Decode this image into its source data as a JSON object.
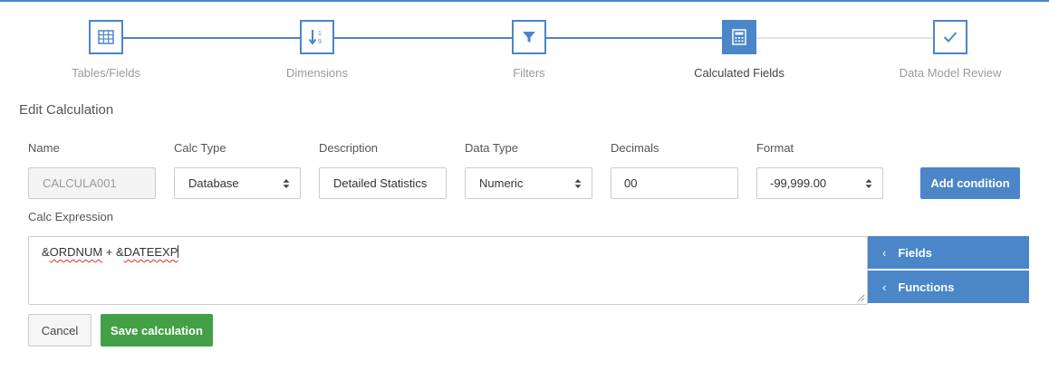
{
  "wizard": {
    "steps": [
      {
        "label": "Tables/Fields",
        "icon": "table-icon",
        "active": false
      },
      {
        "label": "Dimensions",
        "icon": "sort-numeric-icon",
        "active": false
      },
      {
        "label": "Filters",
        "icon": "filter-icon",
        "active": false
      },
      {
        "label": "Calculated Fields",
        "icon": "calculator-icon",
        "active": true
      },
      {
        "label": "Data Model Review",
        "icon": "check-icon",
        "active": false
      }
    ]
  },
  "form": {
    "title": "Edit Calculation",
    "name": {
      "label": "Name",
      "value": "CALCULA001"
    },
    "calc_type": {
      "label": "Calc Type",
      "value": "Database"
    },
    "description": {
      "label": "Description",
      "value": "Detailed Statistics"
    },
    "data_type": {
      "label": "Data Type",
      "value": "Numeric"
    },
    "decimals": {
      "label": "Decimals",
      "value": "00"
    },
    "format": {
      "label": "Format",
      "value": "-99,999.00"
    },
    "add_condition_label": "Add condition",
    "expression": {
      "label": "Calc Expression",
      "part1": "&",
      "part2": "ORDNUM",
      "part3": " + &",
      "part4": "DATEEXP"
    }
  },
  "side_panel": {
    "fields_label": "Fields",
    "functions_label": "Functions"
  },
  "actions": {
    "cancel_label": "Cancel",
    "save_label": "Save calculation"
  },
  "colors": {
    "accent": "#4a86c8",
    "success": "#43a047",
    "inactive_line": "#e3e3e3"
  }
}
